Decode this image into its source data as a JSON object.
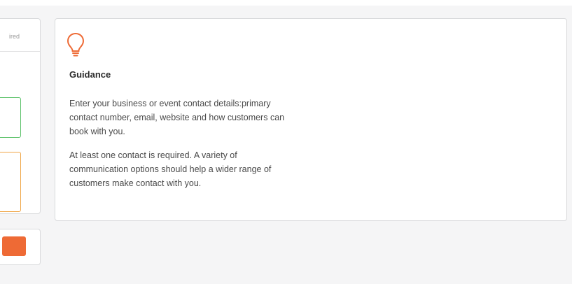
{
  "left_panel": {
    "required_text": "ired"
  },
  "guidance": {
    "icon": "lightbulb-icon",
    "title": "Guidance",
    "paragraphs": [
      "Enter your business or event contact details:primary contact number, email, website and how customers can book with you.",
      "At least one contact is required. A variety of communication options should help a wider range of customers make contact with you."
    ]
  },
  "colors": {
    "accent": "#ee6a35",
    "valid_border": "#5cc26a",
    "warning_border": "#f0a648"
  }
}
